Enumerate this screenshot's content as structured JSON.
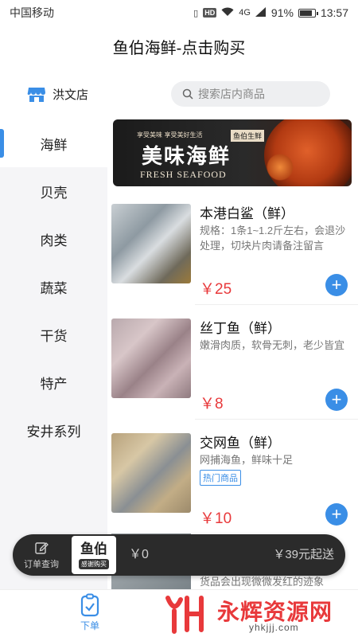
{
  "status_bar": {
    "carrier": "中国移动",
    "hd": "HD",
    "network": "4G",
    "battery": "91%",
    "battery_level": 0.91,
    "time": "13:57"
  },
  "header": {
    "title": "鱼伯海鲜-点击购买"
  },
  "store": {
    "name": "洪文店",
    "icon": "store-icon"
  },
  "search": {
    "placeholder": "搜索店内商品",
    "icon": "search-icon"
  },
  "categories": [
    {
      "label": "海鲜",
      "active": true
    },
    {
      "label": "贝壳",
      "active": false
    },
    {
      "label": "肉类",
      "active": false
    },
    {
      "label": "蔬菜",
      "active": false
    },
    {
      "label": "干货",
      "active": false
    },
    {
      "label": "特产",
      "active": false
    },
    {
      "label": "安井系列",
      "active": false
    }
  ],
  "banner": {
    "small_text": "享受美味 享受美好生活",
    "tag": "鱼伯生鲜",
    "title": "美味海鲜",
    "subtitle": "FRESH SEAFOOD"
  },
  "products": [
    {
      "name": "本港白鲨（鲜）",
      "desc": "规格：1条1~1.2斤左右，会退沙处理，切块片肉请备注留言",
      "tag": "",
      "price": "￥25"
    },
    {
      "name": "丝丁鱼（鲜）",
      "desc": "嫩滑肉质，软骨无刺，老少皆宜",
      "tag": "",
      "price": "￥8"
    },
    {
      "name": "交网鱼（鲜）",
      "desc": "网捕海鱼，鲜味十足",
      "tag": "热门商品",
      "price": "￥10"
    }
  ],
  "partial_item": {
    "desc": "货品会出现微微发红的迹象"
  },
  "cart": {
    "order_query": "订单查询",
    "logo_main": "鱼伯",
    "logo_sub": "感谢购买",
    "amount": "￥0",
    "min_order": "￥39元起送"
  },
  "bottom_nav": {
    "order_label": "下单",
    "watermark_text": "永辉资源网",
    "watermark_url": "yhkjjj.com"
  },
  "colors": {
    "accent": "#3a8ee6",
    "price": "#e8393b",
    "cart_bg": "#2b2b2b"
  }
}
